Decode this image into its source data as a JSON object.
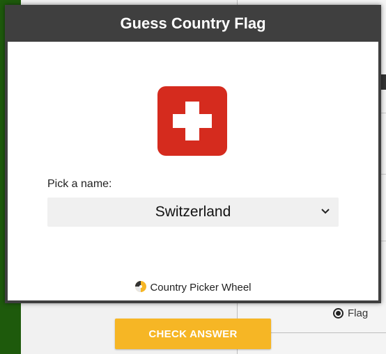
{
  "modal": {
    "title": "Guess Country Flag",
    "flag_icon": "switzerland-flag-icon",
    "flag_colors": {
      "red": "#d52b1e",
      "white": "#ffffff"
    },
    "pick_label": "Pick a name:",
    "select": {
      "selected": "Switzerland"
    },
    "footer": {
      "logo_icon": "picker-wheel-logo-icon",
      "text": "Country Picker Wheel"
    }
  },
  "background": {
    "radio_flag_label": "Flag",
    "radio_flag_selected": true
  },
  "check_answer_label": "CHECK ANSWER",
  "colors": {
    "accent": "#f6b625",
    "modal_header": "#3f3f3f",
    "bg_green": "#1e5a0c"
  }
}
